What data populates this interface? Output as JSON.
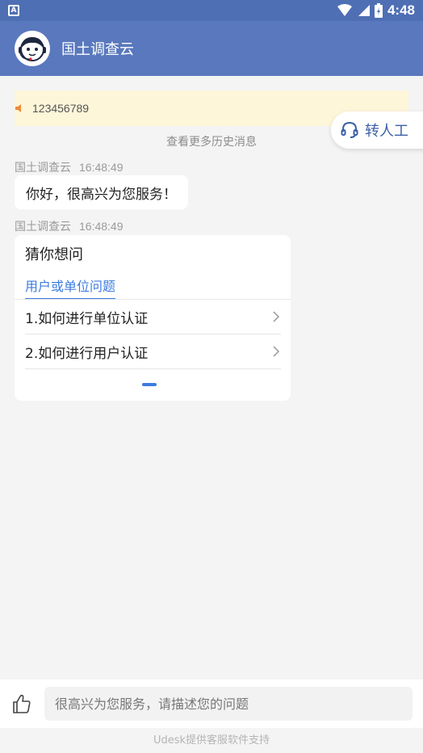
{
  "status_bar": {
    "app_badge": "A",
    "time": "4:48",
    "icons": [
      "wifi-icon",
      "signal-icon",
      "battery-icon"
    ]
  },
  "header": {
    "title": "国土调查云",
    "avatar_icon": "agent-avatar-icon",
    "background": "#5978bd"
  },
  "notice": {
    "text": "123456789",
    "icon": "speaker-icon"
  },
  "transfer_button": {
    "label": "转人工",
    "icon": "headset-icon"
  },
  "history_link": "查看更多历史消息",
  "messages": [
    {
      "sender": "国土调查云",
      "time": "16:48:49",
      "text": "你好，很高兴为您服务！"
    },
    {
      "sender": "国土调查云",
      "time": "16:48:49"
    }
  ],
  "faq_card": {
    "title": "猜你想问",
    "active_tab": "用户或单位问题",
    "questions": [
      "1.如何进行单位认证",
      "2.如何进行用户认证"
    ],
    "accent": "#3d7be0"
  },
  "input_bar": {
    "placeholder": "很高兴为您服务，请描述您的问题",
    "like_icon": "thumbs-up-icon"
  },
  "footer": "Udesk提供客服软件支持"
}
